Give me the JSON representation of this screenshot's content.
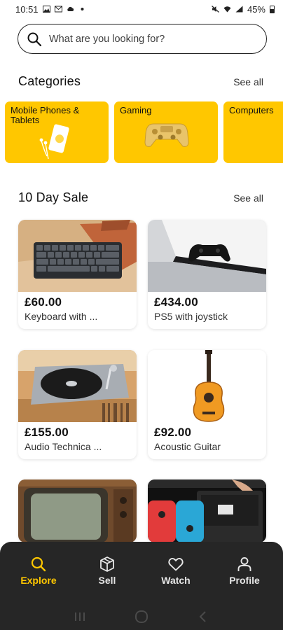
{
  "status_bar": {
    "time": "10:51",
    "battery": "45%"
  },
  "search": {
    "placeholder": "What are you looking for?"
  },
  "categories": {
    "title": "Categories",
    "see_all": "See all",
    "items": [
      {
        "label": "Mobile Phones & Tablets",
        "icon": "phone-earbuds-image"
      },
      {
        "label": "Gaming",
        "icon": "gamepad-image"
      },
      {
        "label": "Computers",
        "icon": ""
      }
    ]
  },
  "sale": {
    "title": "10 Day Sale",
    "see_all": "See all",
    "products": [
      {
        "price": "£60.00",
        "name": "Keyboard with ...",
        "image": "keyboard-photo"
      },
      {
        "price": "£434.00",
        "name": "PS5 with joystick",
        "image": "ps5-photo"
      },
      {
        "price": "£155.00",
        "name": "Audio Technica ...",
        "image": "turntable-photo"
      },
      {
        "price": "£92.00",
        "name": "Acoustic Guitar",
        "image": "guitar-photo"
      },
      {
        "price": "",
        "name": "",
        "image": "retro-tv-photo"
      },
      {
        "price": "",
        "name": "",
        "image": "nintendo-switch-photo"
      }
    ]
  },
  "nav": {
    "items": [
      {
        "label": "Explore",
        "icon": "search-icon",
        "active": true
      },
      {
        "label": "Sell",
        "icon": "box-icon",
        "active": false
      },
      {
        "label": "Watch",
        "icon": "heart-icon",
        "active": false
      },
      {
        "label": "Profile",
        "icon": "person-icon",
        "active": false
      }
    ]
  },
  "colors": {
    "accent": "#ffc700",
    "nav_bg": "#262626"
  }
}
